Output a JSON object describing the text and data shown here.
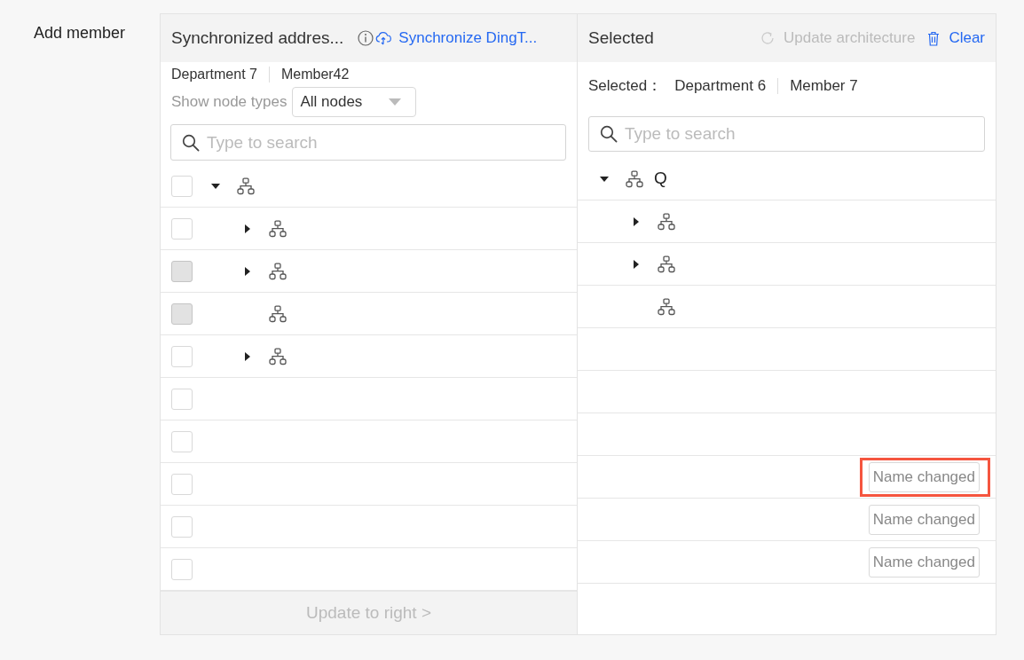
{
  "form_label": "Add member",
  "source_panel": {
    "title": "Synchronized addres...",
    "sync_link": "Synchronize DingT...",
    "counts": [
      "Department 7",
      "Member42"
    ],
    "node_filter": {
      "label": "Show node types",
      "value": "All nodes"
    },
    "search": {
      "placeholder": "Type to search"
    },
    "tree": [
      {
        "kind": "department",
        "checked": false,
        "disabled": false,
        "expanded": true,
        "children": [
          {
            "kind": "department",
            "checked": false,
            "disabled": false,
            "expanded": false
          },
          {
            "kind": "department",
            "checked": false,
            "disabled": true,
            "expanded": false
          },
          {
            "kind": "department",
            "checked": false,
            "disabled": true
          },
          {
            "kind": "department",
            "checked": false,
            "disabled": false,
            "expanded": false
          },
          {
            "kind": "member",
            "checked": false,
            "disabled": false
          },
          {
            "kind": "member",
            "checked": false,
            "disabled": false
          },
          {
            "kind": "member",
            "checked": false,
            "disabled": false
          },
          {
            "kind": "member",
            "checked": false,
            "disabled": false
          },
          {
            "kind": "member",
            "checked": false,
            "disabled": false
          }
        ]
      }
    ],
    "footer_button": {
      "label": "Update to right >",
      "disabled": true
    }
  },
  "selected_panel": {
    "title": "Selected",
    "update_button": {
      "label": "Update architecture",
      "disabled": true
    },
    "clear_button": "Clear",
    "summary": {
      "label": "Selected：",
      "counts": [
        "Department 6",
        "Member 7"
      ]
    },
    "search": {
      "placeholder": "Type to search"
    },
    "tree": [
      {
        "kind": "department",
        "label": "Q",
        "expanded": true,
        "children": [
          {
            "kind": "department",
            "expanded": false
          },
          {
            "kind": "department",
            "expanded": false
          },
          {
            "kind": "department"
          },
          {
            "kind": "member"
          },
          {
            "kind": "member"
          },
          {
            "kind": "member"
          },
          {
            "kind": "member",
            "tag": {
              "label": "Name changed",
              "highlighted": true
            }
          },
          {
            "kind": "member",
            "tag": {
              "label": "Name changed",
              "highlighted": false
            }
          },
          {
            "kind": "member",
            "tag": {
              "label": "Name changed",
              "highlighted": false
            }
          }
        ]
      }
    ]
  }
}
